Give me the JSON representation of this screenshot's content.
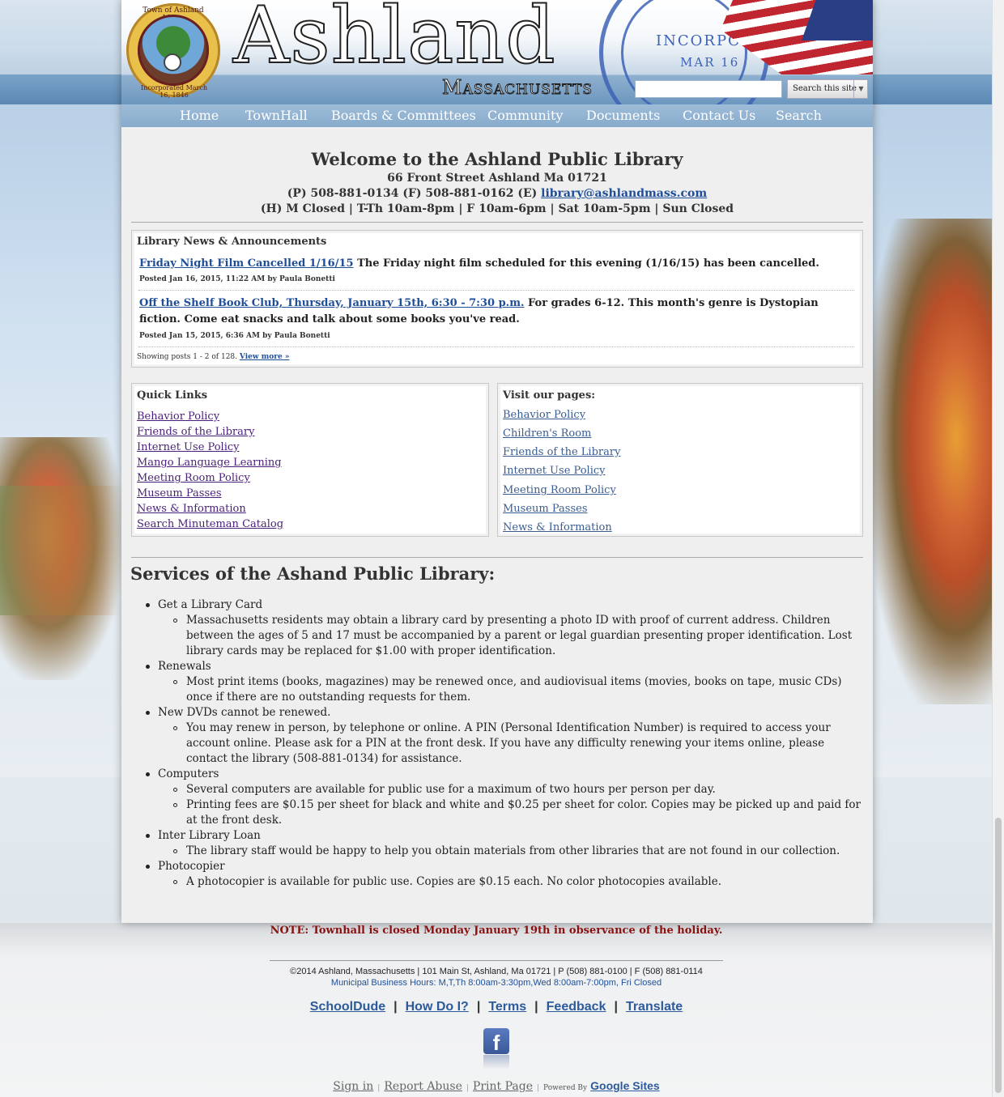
{
  "header": {
    "seal_top": "Town of Ashland Mass.",
    "seal_bottom": "Incorporated March 16, 1846",
    "title": "Ashland",
    "subtitle": "Massachusetts",
    "stamp_text": "INCORPORATED",
    "stamp_date": "MAR 16",
    "search_placeholder": "",
    "search_button": "Search this site"
  },
  "nav": [
    "Home",
    "TownHall",
    "Boards & Committees",
    "Community",
    "Documents",
    "Contact Us",
    "Search"
  ],
  "welcome": {
    "title": "Welcome to the Ashland Public Library",
    "address": "66 Front Street Ashland Ma 01721",
    "phones": "(P) 508-881-0134 (F) 508-881-0162 (E) ",
    "email": "library@ashlandmass.com",
    "hours": "(H) M Closed | T-Th 10am-8pm | F 10am-6pm | Sat 10am-5pm | Sun Closed"
  },
  "news": {
    "title": "Library News & Announcements",
    "posts": [
      {
        "link": "Friday Night Film Cancelled 1/16/15",
        "text": " The Friday night film scheduled for this evening (1/16/15) has been cancelled.",
        "meta": "Posted Jan 16, 2015, 11:22 AM by Paula Bonetti"
      },
      {
        "link": "Off the Shelf Book Club, Thursday, January 15th, 6:30 - 7:30 p.m.",
        "text": " For grades 6-12.  This month's genre is Dystopian fiction.  Come eat snacks and talk about some books you've read.",
        "meta": "Posted Jan 15, 2015, 6:36 AM by Paula Bonetti"
      }
    ],
    "showing": "Showing posts 1 - 2 of 128. ",
    "view_more": "View more »"
  },
  "quick_links": {
    "title": "Quick Links",
    "items": [
      "Behavior Policy",
      "Friends of the Library",
      "Internet Use Policy",
      "Mango Language Learning",
      "Meeting Room Policy",
      "Museum Passes",
      "News & Information",
      "Search Minuteman Catalog"
    ]
  },
  "visit_pages": {
    "title": "Visit our pages:",
    "items": [
      "Behavior Policy",
      "Children's Room",
      "Friends of the Library",
      "Internet Use Policy",
      "Meeting Room Policy",
      "Museum Passes",
      "News & Information"
    ]
  },
  "services": {
    "title": "Services of the Ashand Public Library:",
    "items": [
      {
        "label": "Get a Library Card",
        "subs": [
          "Massachusetts residents may obtain a library card by presenting a photo ID with proof of current address.   Children between the ages of 5 and 17 must be accompanied by a parent or legal guardian presenting proper identification.  Lost library cards may be replaced for $1.00 with proper identification."
        ]
      },
      {
        "label": "Renewals",
        "subs": [
          "Most print items (books, magazines) may be renewed once, and audiovisual items (movies, books on tape, music CDs) once if there are no outstanding requests for them."
        ]
      },
      {
        "label": "New DVDs cannot be renewed.",
        "subs": [
          "You may renew in person, by telephone or online. A PIN (Personal Identification Number) is required to access your account online.  Please ask for a PIN at the front desk.   If you have any difficulty renewing your items online, please contact the library (508-881-0134) for assistance."
        ]
      },
      {
        "label": "Computers",
        "subs": [
          "Several computers are available for public use for a maximum of two hours per person per day.",
          "Printing fees are $0.15 per sheet for black and white and $0.25 per sheet for color.  Copies may be picked up and paid for at the front desk."
        ]
      },
      {
        "label": "Inter Library Loan",
        "subs": [
          "The library staff would be happy to help you obtain materials from other libraries that are not found in our collection."
        ]
      },
      {
        "label": "Photocopier",
        "subs": [
          "A photocopier is available for public use. Copies are $0.15 each.  No color photocopies available."
        ]
      }
    ]
  },
  "footer": {
    "note": "NOTE: Townhall is closed Monday January 19th in observance of the holiday.",
    "address": "©2014 Ashland, Massachusetts |  101 Main St, Ashland, Ma 01721  |  P (508) 881-0100  |   F (508) 881-0114",
    "hours": "Municipal Business Hours: M,T,Th 8:00am-3:30pm,Wed 8:00am-7:00pm, Fri Closed",
    "links": [
      "SchoolDude",
      "How Do I?",
      "Terms",
      "Feedback",
      "Translate"
    ],
    "separator": "|",
    "facebook": "f",
    "sign_in": "Sign in",
    "report_abuse": "Report Abuse",
    "print_page": "Print Page",
    "powered_by": "Powered By",
    "google_sites": "Google Sites"
  }
}
